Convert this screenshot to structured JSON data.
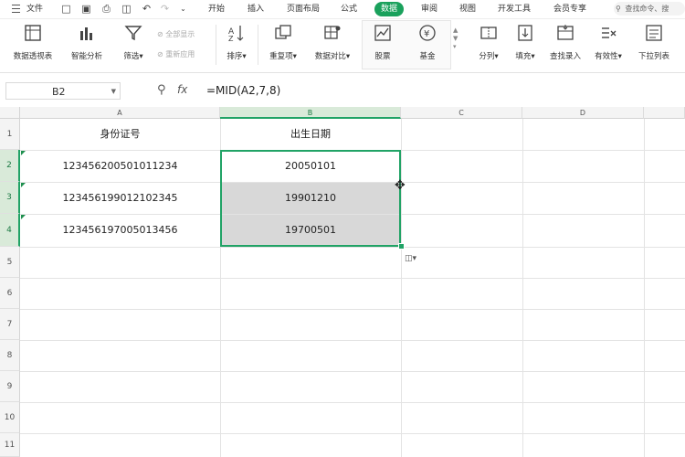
{
  "menu": {
    "file": "文件",
    "tabs": [
      "开始",
      "插入",
      "页面布局",
      "公式",
      "数据",
      "审阅",
      "视图",
      "开发工具",
      "会员专享"
    ],
    "active_tab": "数据",
    "search_placeholder": "查找命令、搜"
  },
  "ribbon": {
    "pivot": "数据透视表",
    "smart_analysis": "智能分析",
    "filter": "筛选",
    "show_all": "全部显示",
    "reapply": "重新应用",
    "sort": "排序",
    "duplicates": "重复项",
    "compare": "数据对比",
    "stock": "股票",
    "fund": "基金",
    "split": "分列",
    "fill": "填充",
    "lookup": "查找录入",
    "validity": "有效性",
    "dropdown": "下拉列表"
  },
  "formula_bar": {
    "cell_ref": "B2",
    "fx": "fx",
    "formula": "=MID(A2,7,8)"
  },
  "sheet": {
    "columns": [
      "A",
      "B",
      "C",
      "D"
    ],
    "rows": [
      "1",
      "2",
      "3",
      "4",
      "5",
      "6",
      "7",
      "8",
      "9",
      "10",
      "11"
    ],
    "header_a": "身份证号",
    "header_b": "出生日期",
    "ids": [
      "123456200501011234",
      "123456199012102345",
      "123456197005013456"
    ],
    "dates": [
      "20050101",
      "19901210",
      "19700501"
    ]
  },
  "colors": {
    "accent": "#21a366",
    "active_tab": "#1aa15c",
    "selected_fill": "#d8d8d8"
  }
}
